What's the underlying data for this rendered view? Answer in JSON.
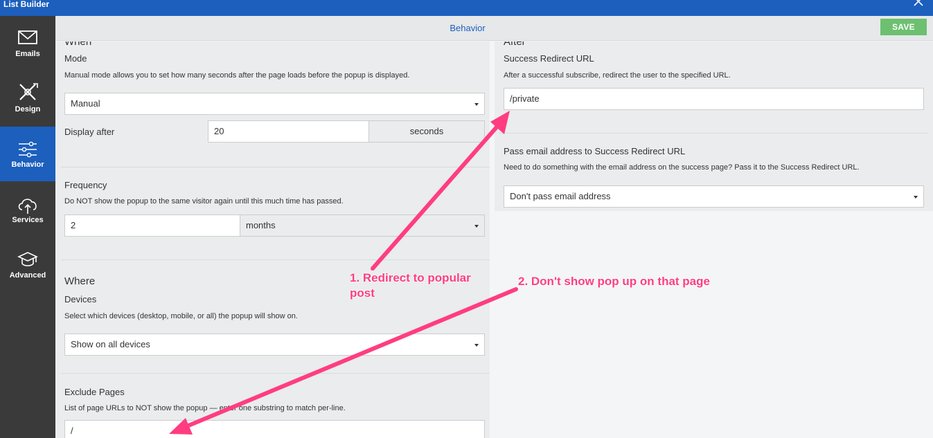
{
  "window": {
    "title": "List Builder"
  },
  "sidebar": {
    "items": [
      {
        "label": "Emails",
        "icon": "envelope-icon"
      },
      {
        "label": "Design",
        "icon": "brush-pencil-icon"
      },
      {
        "label": "Behavior",
        "icon": "sliders-icon",
        "active": true
      },
      {
        "label": "Services",
        "icon": "cloud-upload-icon"
      },
      {
        "label": "Advanced",
        "icon": "graduation-cap-icon"
      }
    ]
  },
  "header": {
    "tab": "Behavior",
    "save_label": "SAVE"
  },
  "when": {
    "heading": "When",
    "mode": {
      "label": "Mode",
      "desc": "Manual mode allows you to set how many seconds after the page loads before the popup is displayed.",
      "value": "Manual"
    },
    "display_after": {
      "label": "Display after",
      "value": "20",
      "unit": "seconds"
    },
    "frequency": {
      "label": "Frequency",
      "desc": "Do NOT show the popup to the same visitor again until this much time has passed.",
      "value": "2",
      "unit": "months"
    }
  },
  "where": {
    "heading": "Where",
    "devices": {
      "label": "Devices",
      "desc": "Select which devices (desktop, mobile, or all) the popup will show on.",
      "value": "Show on all devices"
    },
    "exclude": {
      "label": "Exclude Pages",
      "desc": "List of page URLs to NOT show the popup — enter one substring to match per-line.",
      "value": "/"
    }
  },
  "after": {
    "heading": "After",
    "redirect": {
      "label": "Success Redirect URL",
      "desc": "After a successful subscribe, redirect the user to the specified URL.",
      "value": "/private"
    },
    "pass_email": {
      "label": "Pass email address to Success Redirect URL",
      "desc": "Need to do something with the email address on the success page? Pass it to the Success Redirect URL.",
      "value": "Don't pass email address"
    }
  },
  "annotations": {
    "one": "1. Redirect to popular post",
    "two": "2. Don't show pop up on that page"
  },
  "colors": {
    "accent": "#1c5fbd",
    "save": "#6cc070",
    "annotation": "#ff3d80",
    "sidebar": "#3a3a3a"
  }
}
